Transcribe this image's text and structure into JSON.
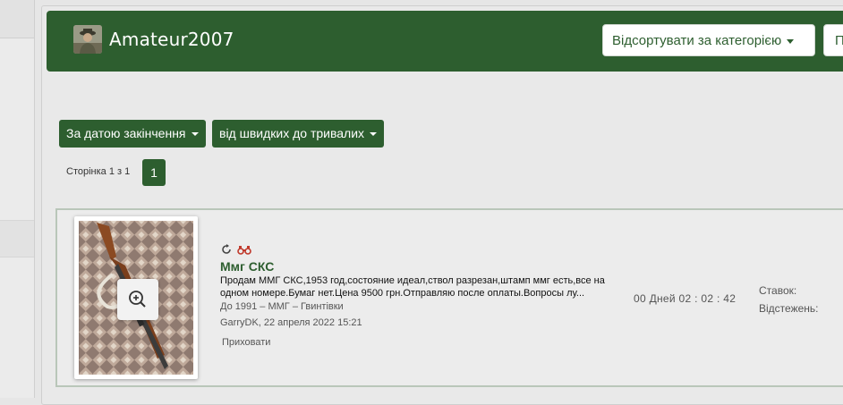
{
  "header": {
    "username": "Amateur2007",
    "sort_category_label": "Відсортувати за категорією",
    "second_button_label": "П"
  },
  "filters": {
    "date_label": "За датою закінчення",
    "duration_label": "від швидких до тривалих"
  },
  "pager": {
    "label": "Сторінка 1 з 1",
    "current_page": "1"
  },
  "listing": {
    "title": "Ммг СКС",
    "description": "Продам ММГ СКС,1953 год,состояние идеал,ствол разрезан,штамп ммг есть,все на одном номере.Бумаг нет.Цена 9500 грн.Отправляю после оплаты.Вопросы лу...",
    "meta_price": "До 1991",
    "meta_cat1": "ММГ",
    "meta_cat2": "Гвинтівки",
    "meta_sep": "–",
    "seller_line": "GarryDK, 22 апреля 2022 15:21",
    "hide_label": "Приховати",
    "timer": "00 Дней 02 : 02 : 42",
    "bids_label": "Ставок:",
    "watch_label": "Відстежень:"
  },
  "icons": {
    "refresh": "refresh-icon",
    "binoculars": "binoculars-icon",
    "zoom": "zoom-in-icon",
    "caret": "chevron-down-icon"
  },
  "colors": {
    "brand_green": "#2d5e2f",
    "page_bg": "#e6e6e6",
    "binoculars_red": "#c0392b"
  }
}
